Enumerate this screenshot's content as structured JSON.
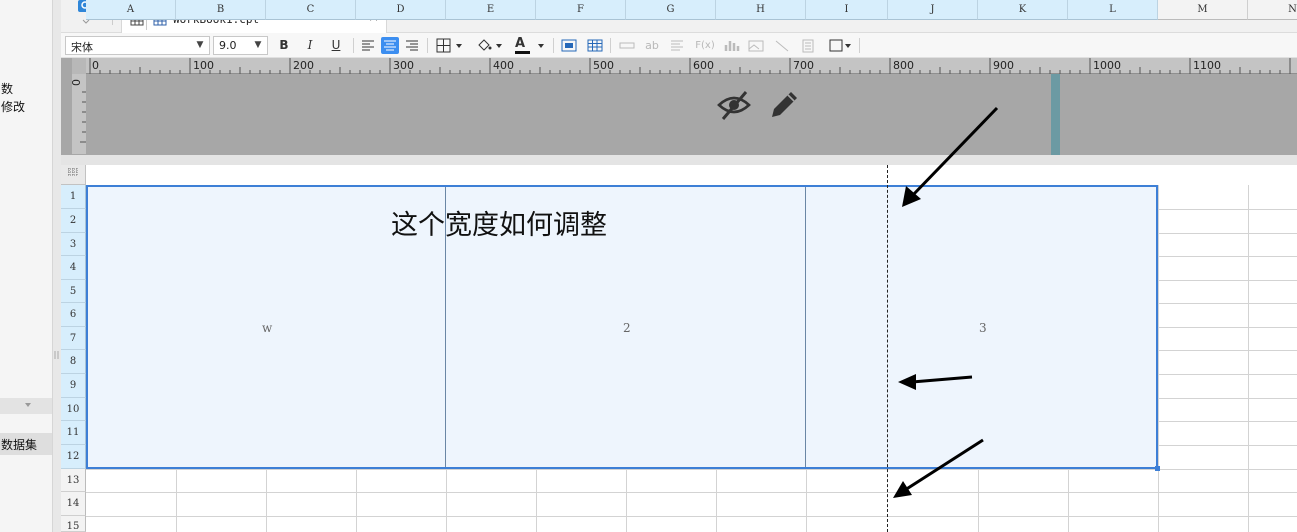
{
  "left_panel": {
    "text_1": "数",
    "text_2": "修改",
    "dataset_label": "数据集"
  },
  "tab": {
    "title": "WorkBook1.cpt",
    "close": "×"
  },
  "toolbar": {
    "font_family": "宋体",
    "font_size": "9.0",
    "bold": "B",
    "italic": "I",
    "underline": "U",
    "font_color_glyph": "A",
    "formula_glyph": "F(x)",
    "text_glyph": "ab"
  },
  "ruler": {
    "origin": "0",
    "v_origin": "0",
    "labels": [
      "100",
      "200",
      "300",
      "400",
      "500",
      "600",
      "700",
      "800",
      "900",
      "1000",
      "1100"
    ]
  },
  "sheet": {
    "columns": [
      "A",
      "B",
      "C",
      "D",
      "E",
      "F",
      "G",
      "H",
      "I",
      "J",
      "K",
      "L",
      "M",
      "N"
    ],
    "rows": [
      "1",
      "2",
      "3",
      "4",
      "5",
      "6",
      "7",
      "8",
      "9",
      "10",
      "11",
      "12",
      "13",
      "14",
      "15"
    ],
    "cells": {
      "w": "w",
      "two": "2",
      "three": "3"
    }
  },
  "annotation": {
    "question": "这个宽度如何调整"
  },
  "colors": {
    "selection_border": "#3d7fd6",
    "selection_fill": "#eef5fd",
    "header_selected": "#d7eefc",
    "ruler_bg": "#a7a7a7",
    "ruler_marker": "#6c9aa3"
  }
}
